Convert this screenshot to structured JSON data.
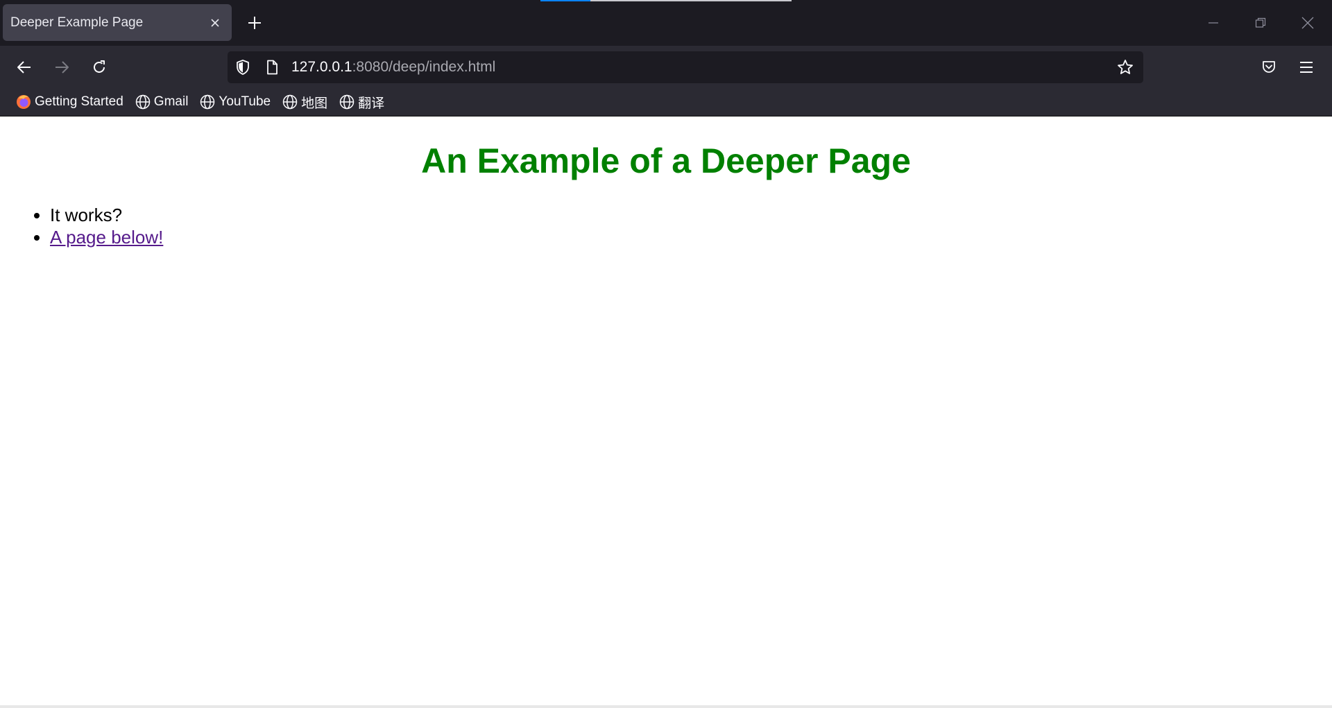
{
  "browser": {
    "tab": {
      "title": "Deeper Example Page"
    },
    "url": {
      "host": "127.0.0.1",
      "rest": ":8080/deep/index.html"
    },
    "bookmarks": [
      {
        "label": "Getting Started",
        "icon": "firefox-icon"
      },
      {
        "label": "Gmail",
        "icon": "globe-icon"
      },
      {
        "label": "YouTube",
        "icon": "globe-icon"
      },
      {
        "label": "地图",
        "icon": "globe-icon"
      },
      {
        "label": "翻译",
        "icon": "globe-icon"
      }
    ],
    "colors": {
      "frame": "#1c1b22",
      "toolbar": "#2b2a33",
      "tab_selected": "#42414d"
    }
  },
  "page": {
    "heading": "An Example of a Deeper Page",
    "heading_color": "#008000",
    "items": [
      {
        "text": "It works?"
      },
      {
        "text": "A page below!",
        "link": true
      }
    ]
  }
}
